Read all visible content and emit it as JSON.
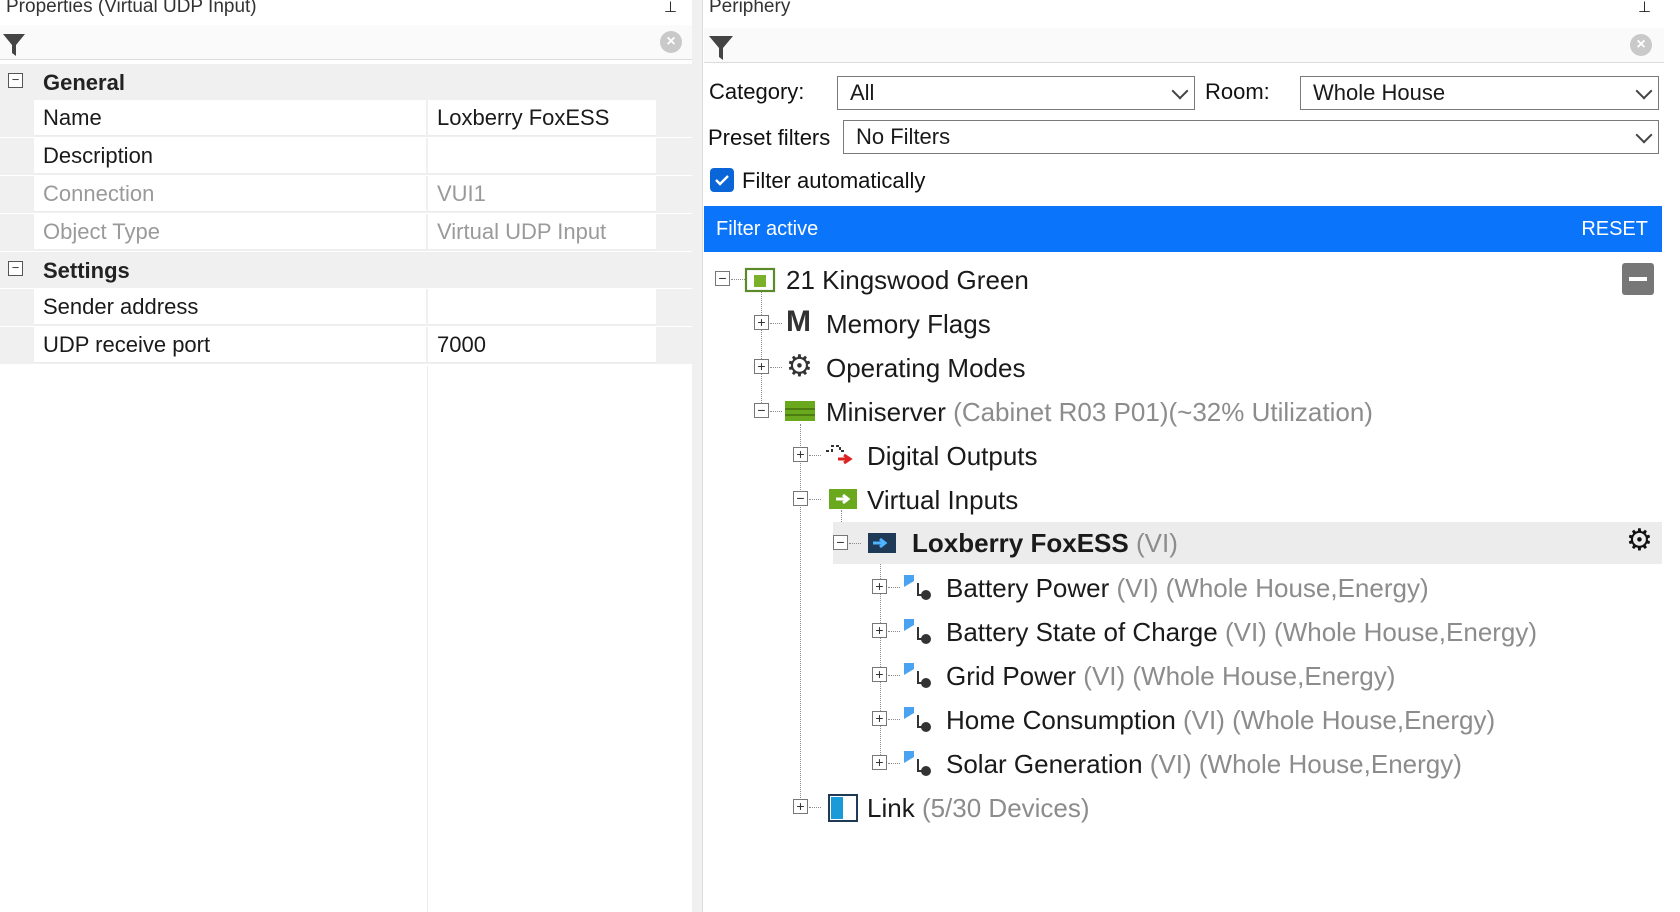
{
  "properties": {
    "title": "Properties (Virtual UDP Input)",
    "categories": [
      {
        "label": "General",
        "toggle": "−"
      },
      {
        "label": "Settings",
        "toggle": "−"
      }
    ],
    "general_rows": [
      {
        "key": "Name",
        "value": "Loxberry FoxESS",
        "readonly": false
      },
      {
        "key": "Description",
        "value": "",
        "readonly": false
      },
      {
        "key": "Connection",
        "value": "VUI1",
        "readonly": true
      },
      {
        "key": "Object Type",
        "value": "Virtual UDP Input",
        "readonly": true
      }
    ],
    "settings_rows": [
      {
        "key": "Sender address",
        "value": "",
        "readonly": false
      },
      {
        "key": "UDP receive port",
        "value": "7000",
        "readonly": false
      }
    ]
  },
  "periphery": {
    "title": "Periphery",
    "category_label": "Category:",
    "category_value": "All",
    "room_label": "Room:",
    "room_value": "Whole House",
    "preset_label": "Preset filters",
    "preset_value": "No Filters",
    "filter_auto_label": "Filter automatically",
    "filter_auto_checked": true,
    "banner_text": "Filter active",
    "reset_label": "RESET",
    "banner_color": "#0a74fa",
    "tree": {
      "root": "21 Kingswood Green",
      "memory_flags": "Memory Flags",
      "operating_modes": "Operating Modes",
      "miniserver": "Miniserver",
      "miniserver_sub": "(Cabinet R03 P01)(~32% Utilization)",
      "digital_outputs": "Digital Outputs",
      "virtual_inputs": "Virtual Inputs",
      "foxess": "Loxberry FoxESS",
      "foxess_sub": "(VI)",
      "children": [
        {
          "label": "Battery Power",
          "sub": "(VI) (Whole House,Energy)"
        },
        {
          "label": "Battery State of Charge",
          "sub": "(VI) (Whole House,Energy)"
        },
        {
          "label": "Grid Power",
          "sub": "(VI) (Whole House,Energy)"
        },
        {
          "label": "Home Consumption",
          "sub": "(VI) (Whole House,Energy)"
        },
        {
          "label": "Solar Generation",
          "sub": "(VI) (Whole House,Energy)"
        }
      ],
      "link": "Link",
      "link_sub": "(5/30 Devices)"
    }
  }
}
